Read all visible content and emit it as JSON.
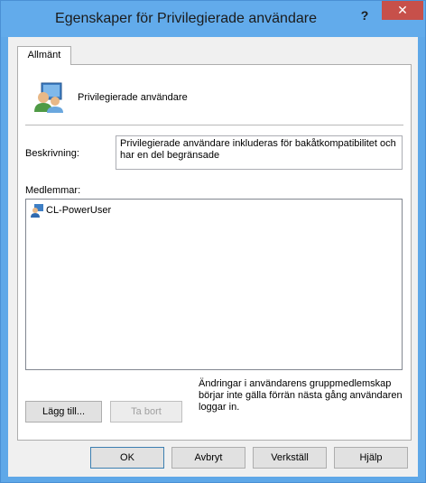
{
  "window": {
    "title": "Egenskaper för Privilegierade användare",
    "help_glyph": "?",
    "close_glyph": "✕"
  },
  "tabs": [
    {
      "label": "Allmänt"
    }
  ],
  "general": {
    "group_name": "Privilegierade användare",
    "description_label": "Beskrivning:",
    "description_value": "Privilegierade användare inkluderas för bakåtkompatibilitet och har en del begränsade",
    "members_label": "Medlemmar:",
    "members": [
      {
        "name": "CL-PowerUser"
      }
    ],
    "add_label": "Lägg till...",
    "remove_label": "Ta bort",
    "note": "Ändringar i användarens gruppmedlemskap börjar inte gälla förrän nästa gång användaren loggar in."
  },
  "footer": {
    "ok_label": "OK",
    "cancel_label": "Avbryt",
    "apply_label": "Verkställ",
    "help_label": "Hjälp"
  },
  "icons": {
    "group": "users-group-icon",
    "member": "user-icon"
  },
  "colors": {
    "titlebar": "#62abeb",
    "close_button": "#c7504a",
    "dialog_background": "#f0f0f0"
  }
}
